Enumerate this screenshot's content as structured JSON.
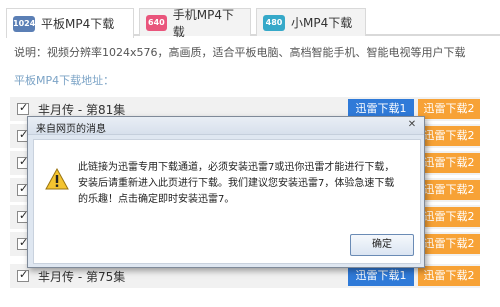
{
  "tabs": [
    {
      "badge": "1024",
      "badge_color": "#5b7fb5",
      "label": "平板MP4下载",
      "active": true
    },
    {
      "badge": "640",
      "badge_color": "#e9557c",
      "label": "手机MP4下载",
      "active": false
    },
    {
      "badge": "480",
      "badge_color": "#36a9c9",
      "label": "小MP4下载",
      "active": false
    }
  ],
  "description": "说明：视频分辨率1024x576，高画质，适合平板电脑、高档智能手机、智能电视等用户下载",
  "section_label": "平板MP4下载地址：",
  "buttons": {
    "download1": "迅雷下载1",
    "download2": "迅雷下载2"
  },
  "episodes": [
    {
      "title": "芈月传 - 第81集",
      "checked": true
    },
    {
      "title": "芈",
      "checked": true
    },
    {
      "title": "芈",
      "checked": true
    },
    {
      "title": "芈",
      "checked": true
    },
    {
      "title": "芈",
      "checked": true
    },
    {
      "title": "芈",
      "checked": true
    },
    {
      "title": "芈月传 - 第75集",
      "checked": true
    }
  ],
  "dialog": {
    "title": "来自网页的消息",
    "close": "✕",
    "message": "此链接为迅雷专用下载通道，必须安装迅雷7或迅你迅雷才能进行下载，安装后请重新进入此页进行下载。我们建议您安装迅雷7，体验急速下载的乐趣！点击确定即时安装迅雷7。",
    "ok": "确定"
  },
  "colors": {
    "blue_button": "#2f7ad8",
    "orange_button": "#f7a236",
    "row_background": "#f1f1f1"
  }
}
